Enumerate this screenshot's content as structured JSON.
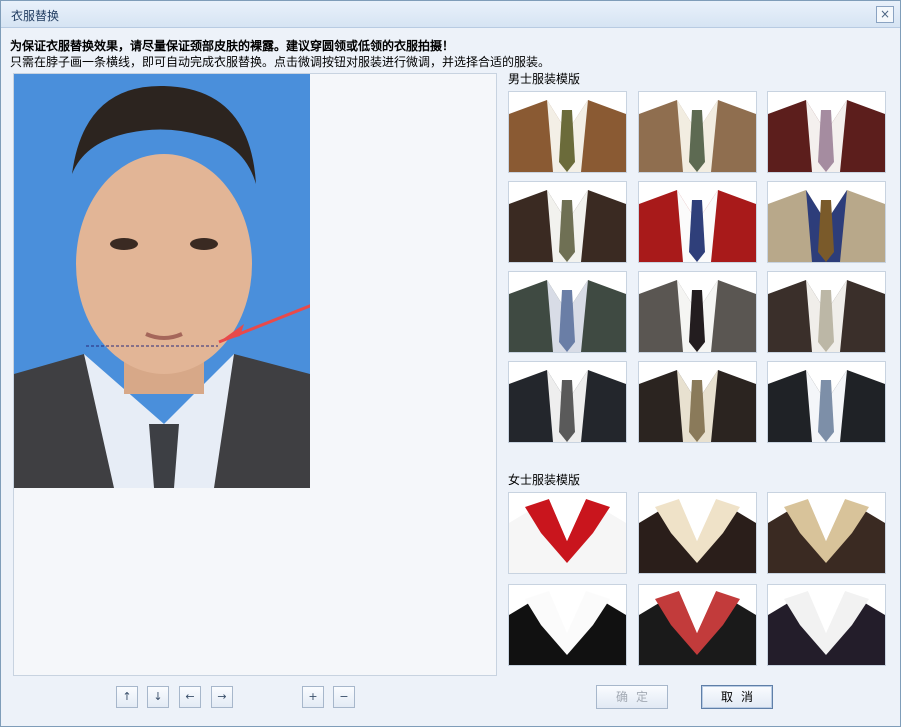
{
  "window": {
    "title": "衣服替换",
    "close_icon": "close-icon"
  },
  "instructions": {
    "warning": "为保证衣服替换效果，请尽量保证颈部皮肤的裸露。建议穿圆领或低领的衣服拍摄！",
    "hint": "只需在脖子画一条横线，即可自动完成衣服替换。点击微调按钮对服装进行微调，并选择合适的服装。"
  },
  "templates": {
    "male_title": "男士服装模版",
    "female_title": "女士服装模版",
    "male": [
      {
        "suit": "#8a5a33",
        "shirt": "#f3efe6",
        "tie": "#6b6b3a"
      },
      {
        "suit": "#8f6e4f",
        "shirt": "#f2ede1",
        "tie": "#5d6a52"
      },
      {
        "suit": "#5c1e1c",
        "shirt": "#f4f0ee",
        "tie": "#a58ca0"
      },
      {
        "suit": "#3a2a22",
        "shirt": "#f2f2ee",
        "tie": "#6f7054"
      },
      {
        "suit": "#a81a1a",
        "shirt": "#fbfbfb",
        "tie": "#2f3f7a"
      },
      {
        "suit": "#b8a88a",
        "shirt": "#2d3d7a",
        "tie": "#7a5a2a"
      },
      {
        "suit": "#3f4a42",
        "shirt": "#d8dce6",
        "tie": "#6a7ea6"
      },
      {
        "suit": "#5a5652",
        "shirt": "#f5f5f3",
        "tie": "#231d1f"
      },
      {
        "suit": "#3a2f2a",
        "shirt": "#f0eeea",
        "tie": "#bcb7a6"
      },
      {
        "suit": "#23262c",
        "shirt": "#eeeeee",
        "tie": "#5a5a5a"
      },
      {
        "suit": "#2b2420",
        "shirt": "#e8e1d0",
        "tie": "#8a7a5a"
      },
      {
        "suit": "#1f2226",
        "shirt": "#f4f6f9",
        "tie": "#7d8fa8"
      }
    ],
    "female": [
      {
        "jacket": "#f6f6f6",
        "collar": "#c9151d"
      },
      {
        "jacket": "#2a1e1a",
        "collar": "#efe2c8"
      },
      {
        "jacket": "#3a2a22",
        "collar": "#d8c39a"
      },
      {
        "jacket": "#111111",
        "collar": "#fbfbfb"
      },
      {
        "jacket": "#1a1a1a",
        "collar": "#c23b3b"
      },
      {
        "jacket": "#231d2a",
        "collar": "#f2f2f2"
      }
    ]
  },
  "adjust": {
    "up_icon": "up-arrow-icon",
    "down_icon": "down-arrow-icon",
    "left_icon": "left-arrow-icon",
    "right_icon": "right-arrow-icon",
    "zoom_in": "+",
    "zoom_out": "−"
  },
  "buttons": {
    "ok": "确定",
    "cancel": "取消"
  }
}
